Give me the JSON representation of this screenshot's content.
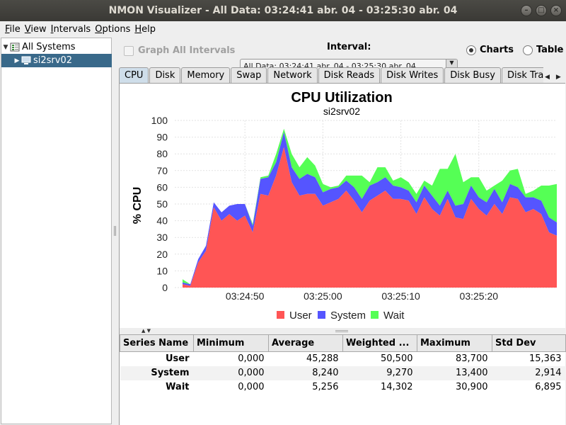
{
  "window": {
    "title": "NMON Visualizer - All Data: 03:24:41 abr. 04 - 03:25:30 abr. 04",
    "btn_min": "–",
    "btn_max": "□",
    "btn_close": "×"
  },
  "menu": [
    {
      "label_u": "F",
      "label_rest": "ile"
    },
    {
      "label_u": "V",
      "label_rest": "iew"
    },
    {
      "label_u": "I",
      "label_rest": "ntervals"
    },
    {
      "label_u": "O",
      "label_rest": "ptions"
    },
    {
      "label_u": "H",
      "label_rest": "elp"
    }
  ],
  "tree": {
    "root": "All Systems",
    "child": "si2srv02",
    "root_icon": "checklist-icon",
    "child_icon": "computer-icon"
  },
  "controls": {
    "graph_all_label": "Graph All Intervals",
    "interval_label": "Interval:",
    "interval_value": "All Data: 03:24:41 abr. 04 - 03:25:30 abr. 04",
    "radio_charts": "Charts",
    "radio_table": "Table",
    "selected_view": "Charts"
  },
  "tabs": [
    "CPU",
    "Disk",
    "Memory",
    "Swap",
    "Network",
    "Disk Reads",
    "Disk Writes",
    "Disk Busy",
    "Disk Transfer"
  ],
  "active_tab": "CPU",
  "chart_data": {
    "type": "area",
    "stacked": true,
    "title": "CPU Utilization",
    "subtitle": "si2srv02",
    "ylabel": "% CPU",
    "xlabel": "",
    "ylim": [
      0,
      100
    ],
    "yticks": [
      "0",
      "10",
      "20",
      "30",
      "40",
      "50",
      "60",
      "70",
      "80",
      "90",
      "100"
    ],
    "xticks": [
      "03:24:50",
      "03:25:00",
      "03:25:10",
      "03:25:20"
    ],
    "xtick_seconds": [
      50,
      60,
      70,
      80
    ],
    "x": [
      42,
      43,
      44,
      45,
      46,
      47,
      48,
      49,
      50,
      51,
      52,
      53,
      54,
      55,
      56,
      57,
      58,
      59,
      60,
      61,
      62,
      63,
      64,
      65,
      66,
      67,
      68,
      69,
      70,
      71,
      72,
      73,
      74,
      75,
      76,
      77,
      78,
      79,
      80,
      81,
      82,
      83,
      84,
      85,
      86,
      87,
      88,
      89,
      90
    ],
    "grid": true,
    "legend_position": "bottom",
    "series": [
      {
        "name": "User",
        "color": "#ff5555",
        "values": [
          2,
          1,
          15,
          22,
          48,
          40,
          44,
          40,
          43,
          33,
          56,
          55,
          67,
          84,
          63,
          55,
          56,
          56,
          49,
          51,
          53,
          58,
          52,
          45,
          52,
          55,
          58,
          53,
          53,
          52,
          44,
          54,
          47,
          43,
          53,
          42,
          41,
          53,
          47,
          43,
          50,
          44,
          54,
          53,
          45,
          47,
          44,
          33,
          31
        ]
      },
      {
        "name": "System",
        "color": "#5555ff",
        "values": [
          1,
          1,
          2,
          3,
          3,
          5,
          5,
          10,
          7,
          4,
          9,
          11,
          8,
          9,
          9,
          10,
          12,
          10,
          8,
          8,
          7,
          6,
          8,
          8,
          9,
          8,
          8,
          8,
          7,
          6,
          7,
          7,
          8,
          6,
          5,
          7,
          9,
          8,
          7,
          8,
          9,
          7,
          8,
          7,
          9,
          7,
          8,
          9,
          8
        ]
      },
      {
        "name": "Wait",
        "color": "#55ff55",
        "values": [
          2,
          0,
          0,
          0,
          0,
          0,
          0,
          0,
          0,
          1,
          1,
          1,
          5,
          2,
          8,
          7,
          10,
          7,
          5,
          1,
          1,
          3,
          7,
          14,
          2,
          9,
          6,
          3,
          6,
          5,
          5,
          3,
          6,
          22,
          13,
          31,
          13,
          5,
          12,
          7,
          2,
          13,
          8,
          11,
          2,
          4,
          9,
          19,
          23
        ]
      }
    ]
  },
  "stats_table": {
    "columns": [
      "Series Name",
      "Minimum",
      "Average",
      "Weighted ...",
      "Maximum",
      "Std Dev"
    ],
    "rows": [
      [
        "User",
        "0,000",
        "45,288",
        "50,500",
        "83,700",
        "15,363"
      ],
      [
        "System",
        "0,000",
        "8,240",
        "9,270",
        "13,400",
        "2,914"
      ],
      [
        "Wait",
        "0,000",
        "5,256",
        "14,302",
        "30,900",
        "6,895"
      ]
    ]
  }
}
